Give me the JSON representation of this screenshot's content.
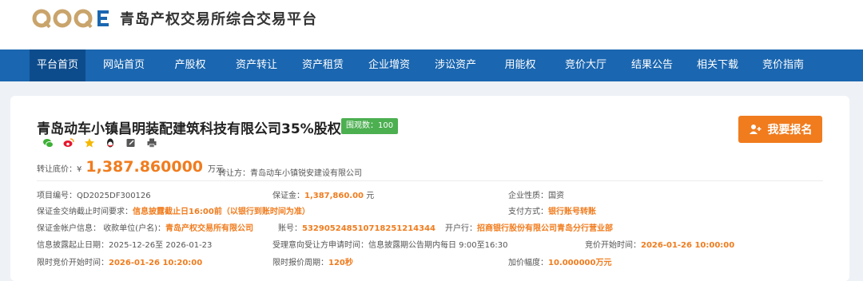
{
  "header": {
    "site_title": "青岛产权交易所综合交易平台",
    "logo_letters": "QOQE",
    "logo_color": "#c9a46b",
    "brand_blue": "#1a66b0"
  },
  "nav": {
    "active_index": 0,
    "items": [
      "平台首页",
      "网站首页",
      "产股权",
      "资产转让",
      "资产租赁",
      "企业增资",
      "涉讼资产",
      "用能权",
      "竞价大厅",
      "结果公告",
      "相关下载",
      "竞价指南"
    ]
  },
  "project": {
    "title": "青岛动车小镇昌明装配建筑科技有限公司35%股权",
    "views_label": "围观数：100",
    "signup_label": "我要报名",
    "accent_color": "#f07c1e",
    "share_icons": [
      "wechat-icon",
      "weibo-icon",
      "star-icon",
      "qq-icon",
      "edit-icon",
      "print-icon"
    ]
  },
  "price": {
    "label": "转让底价：",
    "currency": "¥",
    "value": "1,387.860000",
    "unit": "万元",
    "transferor_label": "转让方：",
    "transferor_value": "青岛动车小镇锐安建设有限公司"
  },
  "details": {
    "project_no_label": "项目编号：",
    "project_no": "QD2025DF300126",
    "deposit_label": "保证金：",
    "deposit_value": "1,387,860.00",
    "deposit_unit": "元",
    "nature_label": "企业性质：",
    "nature_value": "国资",
    "deposit_deadline_label": "保证金交纳截止时间要求：",
    "deposit_deadline_value": "信息披露截止日16:00前（以银行到账时间为准）",
    "pay_method_label": "支付方式：",
    "pay_method_value": "银行账号转账",
    "account_info_label": "保证金帐户信息：",
    "payee_label": "收款单位(户名)：",
    "payee_value": "青岛产权交易所有限公司",
    "account_label": "账号：",
    "account_value": "532905248510718251214344",
    "bank_label": "开户行：",
    "bank_value": "招商银行股份有限公司青岛分行营业部",
    "disclosure_label": "信息披露起止日期：",
    "disclosure_value": "2025-12-26至 2026-01-23",
    "intent_label": "受理意向受让方申请时间：",
    "intent_value": "信息披露期公告期内每日 9:00至16:30",
    "bid_start_label": "竞价开始时间：",
    "bid_start_value": "2026-01-26 10:00:00",
    "limited_start_label": "限时竞价开始时间：",
    "limited_start_value": "2026-01-26 10:20:00",
    "period_label": "限时报价周期：",
    "period_value": "120秒",
    "increment_label": "加价幅度：",
    "increment_value": "10.000000万元"
  }
}
